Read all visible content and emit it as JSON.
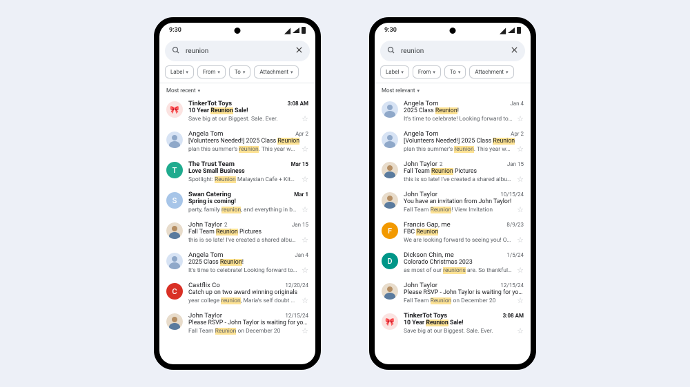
{
  "status": {
    "time": "9:30"
  },
  "search": {
    "value": "reunion"
  },
  "chips": {
    "label": "Label",
    "from": "From",
    "to": "To",
    "attachment": "Attachment"
  },
  "left": {
    "sort": "Most recent",
    "emails": [
      {
        "sender": "TinkerTot Toys",
        "time": "3:08 AM",
        "subject_pre": "10 Year ",
        "subject_hl": "Reunion",
        "subject_post": " Sale!",
        "snippet_pre": "Save big at our Biggest. Sale. Ever.",
        "snippet_hl": "",
        "snippet_post": "",
        "unread": true,
        "avatarType": "icon",
        "avatarBg": "#fbe3e1",
        "avatarChar": "🎀",
        "count": ""
      },
      {
        "sender": "Angela Tom",
        "time": "Apr 2",
        "subject_pre": "[Volunteers Needed!] 2025 Class ",
        "subject_hl": "Reunion",
        "subject_post": "",
        "snippet_pre": "plan this summer's ",
        "snippet_hl": "reunion",
        "snippet_post": ". This year we're…",
        "unread": false,
        "avatarType": "person1",
        "count": ""
      },
      {
        "sender": "The Trust Team",
        "time": "Mar 15",
        "subject_pre": "Love Small Business",
        "subject_hl": "",
        "subject_post": "",
        "snippet_pre": "Spotlight: ",
        "snippet_hl": "Reunion",
        "snippet_post": " Malaysian Cafe + Kitch…",
        "unread": true,
        "avatarType": "letter",
        "avatarBg": "#1fab8e",
        "avatarChar": "T",
        "count": ""
      },
      {
        "sender": "Swan Catering",
        "time": "Mar 1",
        "subject_pre": "Spring is coming!",
        "subject_hl": "",
        "subject_post": "",
        "snippet_pre": "party, family ",
        "snippet_hl": "reunion",
        "snippet_post": ", and everything in bet…",
        "unread": true,
        "avatarType": "letter",
        "avatarBg": "#a7c5e8",
        "avatarChar": "S",
        "count": ""
      },
      {
        "sender": "John Taylor",
        "time": "Jan 15",
        "subject_pre": "Fall Team ",
        "subject_hl": "Reunion",
        "subject_post": " Pictures",
        "snippet_pre": "this is so late!  I've created a shared album t…",
        "snippet_hl": "",
        "snippet_post": "",
        "unread": false,
        "avatarType": "person2",
        "count": "2"
      },
      {
        "sender": "Angela Tom",
        "time": "Jan 4",
        "subject_pre": "2025 Class ",
        "subject_hl": "Reunion",
        "subject_post": "!",
        "snippet_pre": "It's time to celebrate!  Looking forward to se…",
        "snippet_hl": "",
        "snippet_post": "",
        "unread": false,
        "avatarType": "person1",
        "count": ""
      },
      {
        "sender": "Castflix Co",
        "time": "12/20/24",
        "subject_pre": "Catch up on two award winning originals",
        "subject_hl": "",
        "subject_post": "",
        "snippet_pre": "year college ",
        "snippet_hl": "reunion",
        "snippet_post": ", Maria's self doubt and…",
        "unread": false,
        "avatarType": "letter",
        "avatarBg": "#d93025",
        "avatarChar": "C",
        "count": ""
      },
      {
        "sender": "John Taylor",
        "time": "12/15/24",
        "subject_pre": "Please RSVP - John Taylor is waiting for you…",
        "subject_hl": "",
        "subject_post": "",
        "snippet_pre": "Fall Team ",
        "snippet_hl": "Reunion",
        "snippet_post": " on December 20",
        "unread": false,
        "avatarType": "person2",
        "count": ""
      }
    ]
  },
  "right": {
    "sort": "Most relevant",
    "emails": [
      {
        "sender": "Angela Tom",
        "time": "Jan 4",
        "subject_pre": "2025 Class ",
        "subject_hl": "Reunion",
        "subject_post": "!",
        "snippet_pre": "It's time to celebrate!  Looking forward to se…",
        "snippet_hl": "",
        "snippet_post": "",
        "unread": false,
        "avatarType": "person1",
        "count": ""
      },
      {
        "sender": "Angela Tom",
        "time": "Apr 2",
        "subject_pre": "[Volunteers Needed!] 2025 Class ",
        "subject_hl": "Reunion",
        "subject_post": "",
        "snippet_pre": "plan this summer's ",
        "snippet_hl": "reunion",
        "snippet_post": ". This year we're…",
        "unread": false,
        "avatarType": "person1",
        "count": ""
      },
      {
        "sender": "John Taylor",
        "time": "Jan 15",
        "subject_pre": "Fall Team ",
        "subject_hl": "Reunion",
        "subject_post": " Pictures",
        "snippet_pre": "this is so late!  I've created a shared album t…",
        "snippet_hl": "",
        "snippet_post": "",
        "unread": false,
        "avatarType": "person2",
        "count": "2"
      },
      {
        "sender": "John Taylor",
        "time": "10/15/24",
        "subject_pre": "You have an invitation from John Taylor!",
        "subject_hl": "",
        "subject_post": "",
        "snippet_pre": "Fall Team ",
        "snippet_hl": "Reunion",
        "snippet_post": "! View Invitation",
        "unread": false,
        "avatarType": "person2",
        "count": ""
      },
      {
        "sender": "Francis Gap, me",
        "time": "8/9/23",
        "subject_pre": "FBC ",
        "subject_hl": "Reunion",
        "subject_post": "",
        "snippet_pre": "We are looking forward to seeing you!  Our…",
        "snippet_hl": "",
        "snippet_post": "",
        "unread": false,
        "avatarType": "letter",
        "avatarBg": "#f29900",
        "avatarChar": "F",
        "count": ""
      },
      {
        "sender": "Dickson Chin, me",
        "time": "1/5/24",
        "subject_pre": "Colorado Christmas 2023",
        "subject_hl": "",
        "subject_post": "",
        "snippet_pre": "as most of our ",
        "snippet_hl": "reunions",
        "snippet_post": " are.  So thankful for…",
        "unread": false,
        "avatarType": "letter",
        "avatarBg": "#009688",
        "avatarChar": "D",
        "count": ""
      },
      {
        "sender": "John Taylor",
        "time": "12/15/24",
        "subject_pre": "Please RSVP - John Taylor is waiting for you…",
        "subject_hl": "",
        "subject_post": "",
        "snippet_pre": "Fall Team ",
        "snippet_hl": "Reunion",
        "snippet_post": " on December 20",
        "unread": false,
        "avatarType": "person2",
        "count": ""
      },
      {
        "sender": "TinkerTot Toys",
        "time": "3:08 AM",
        "subject_pre": "10 Year ",
        "subject_hl": "Reunion",
        "subject_post": " Sale!",
        "snippet_pre": "Save big at our Biggest. Sale. Ever.",
        "snippet_hl": "",
        "snippet_post": "",
        "unread": true,
        "avatarType": "icon",
        "avatarBg": "#fbe3e1",
        "avatarChar": "🎀",
        "count": ""
      }
    ]
  }
}
